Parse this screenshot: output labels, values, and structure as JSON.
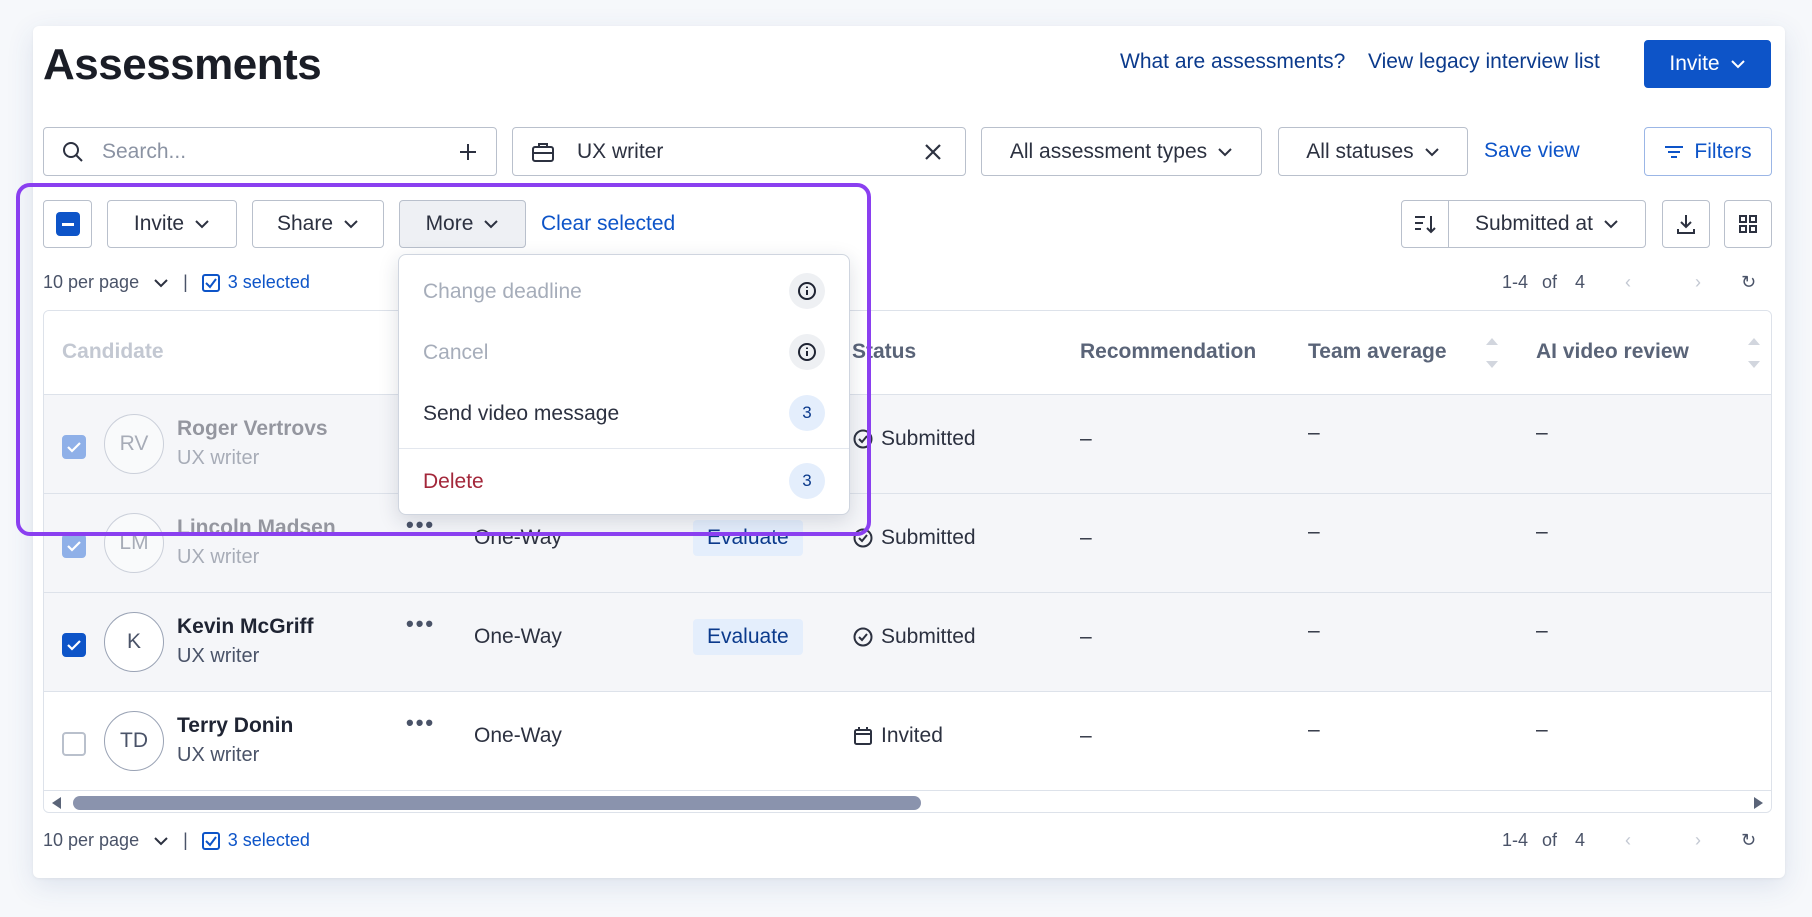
{
  "header": {
    "title": "Assessments",
    "link_what": "What are assessments?",
    "link_legacy": "View legacy interview list",
    "invite_label": "Invite"
  },
  "filters": {
    "search_placeholder": "Search...",
    "job_value": "UX writer",
    "types_label": "All assessment types",
    "statuses_label": "All statuses",
    "save_view": "Save view",
    "filters_label": "Filters"
  },
  "toolbar": {
    "invite": "Invite",
    "share": "Share",
    "more": "More",
    "clear_selected": "Clear selected",
    "sort_label": "Submitted at"
  },
  "pagination": {
    "per_page": "10 per page",
    "selected": "3 selected",
    "range": "1-4",
    "of": "of",
    "total": "4"
  },
  "menu": {
    "items": [
      {
        "label": "Change deadline",
        "badge": "i",
        "disabled": true
      },
      {
        "label": "Cancel",
        "badge": "i",
        "disabled": true
      },
      {
        "label": "Send video message",
        "badge": "3",
        "disabled": false
      },
      {
        "label": "Delete",
        "badge": "3",
        "disabled": false
      }
    ]
  },
  "columns": {
    "candidate": "Candidate",
    "status": "Status",
    "recommendation": "Recommendation",
    "team_average": "Team average",
    "ai_review": "AI video review"
  },
  "rows": [
    {
      "initials": "RV",
      "name": "Roger Vertrovs",
      "role": "UX writer",
      "type": "",
      "action": "",
      "status": "Submitted",
      "recommendation": "–",
      "team_average": "–",
      "ai_review": "–",
      "checked": true
    },
    {
      "initials": "LM",
      "name": "Lincoln Madsen",
      "role": "UX writer",
      "type": "One-Way",
      "action": "Evaluate",
      "status": "Submitted",
      "recommendation": "–",
      "team_average": "–",
      "ai_review": "–",
      "checked": true
    },
    {
      "initials": "K",
      "name": "Kevin McGriff",
      "role": "UX writer",
      "type": "One-Way",
      "action": "Evaluate",
      "status": "Submitted",
      "recommendation": "–",
      "team_average": "–",
      "ai_review": "–",
      "checked": true
    },
    {
      "initials": "TD",
      "name": "Terry Donin",
      "role": "UX writer",
      "type": "One-Way",
      "action": "",
      "status": "Invited",
      "recommendation": "–",
      "team_average": "–",
      "ai_review": "–",
      "checked": false
    }
  ],
  "colors": {
    "primary": "#0d54c8",
    "highlight": "#8a3ff0",
    "danger": "#a3273a"
  }
}
